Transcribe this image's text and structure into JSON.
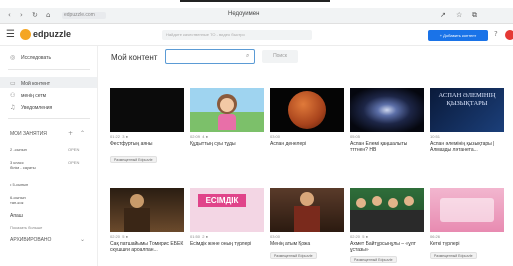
{
  "browser": {
    "url": "edpuzzle.com",
    "window_title": "Недоуимен"
  },
  "header": {
    "logo": "edpuzzle",
    "search_placeholder": "Найдите качественные ТО - видео быстро",
    "add_button": "+ Добавить контент"
  },
  "sidebar": {
    "explore": "Исследовать",
    "my_content": "Мой контент",
    "my_network": "менің сетм",
    "notifications": "Уведомления",
    "classes_heading": "МОИ ЗАНЯТИЯ",
    "classes": [
      {
        "name": "2 -сынып",
        "count": "OPEN"
      },
      {
        "name": "3 класс\nбілім - сауаты",
        "count": "OPEN"
      },
      {
        "name": "• 5-сынып",
        "count": ""
      },
      {
        "name": "6-сынып\nтан-кок",
        "count": ""
      }
    ],
    "more_label": "Апаш",
    "show_more": "Показать больше",
    "archived": "АРХИВИРОВАНО"
  },
  "main": {
    "title": "Мой контент",
    "search_button": "Поиск"
  },
  "cards": [
    {
      "duration": "01:22",
      "questions": "3 ●",
      "title": "Фестфуртың аяны",
      "badge": "Размещенный Edpuzzle",
      "thumb": "dark"
    },
    {
      "duration": "02:09",
      "questions": "4 ●",
      "title": "Құдыттың суы тұды",
      "badge": "",
      "thumb": "cartoon"
    },
    {
      "duration": "03:00",
      "questions": "",
      "title": "Аспан денелері",
      "badge": "",
      "thumb": "mars"
    },
    {
      "duration": "05:05",
      "questions": "",
      "title": "Аспан Елемі қаңшалыты тттнен? HB",
      "badge": "",
      "thumb": "galaxy"
    },
    {
      "duration": "10:51",
      "questions": "",
      "title": "Аспан әлемінің қызықтары | Алмазды ләтанета...",
      "badge": "",
      "thumb": "space-text",
      "thumb_text": "АСПАН ӘЛЕМІНІҢ ҚЫЗЫҚТАРЫ"
    },
    {
      "duration": "02:20",
      "questions": "5 ●",
      "title": "Сақ патшайымы Томирис ЕБЕК скушшғи ароалпан...",
      "badge": "",
      "thumb": "film"
    },
    {
      "duration": "01:50",
      "questions": "2 ●",
      "title": "Есімдік және оның түрлері",
      "badge": "",
      "thumb": "pink-title",
      "thumb_text": "ЕСІМДІК"
    },
    {
      "duration": "03:00",
      "questions": "",
      "title": "Менің атым Қожа",
      "badge": "Размещенный Edpuzzle",
      "thumb": "boy"
    },
    {
      "duration": "02:20",
      "questions": "5 ●",
      "title": "Ахмет Байтұрсынұлы – «ұлт ұстазы»",
      "badge": "Размещенный Edpuzzle",
      "thumb": "group"
    },
    {
      "duration": "06:26",
      "questions": "",
      "title": "Кеткі түрлері",
      "badge": "Размещенный Edpuzzle",
      "thumb": "pink-bg"
    }
  ]
}
